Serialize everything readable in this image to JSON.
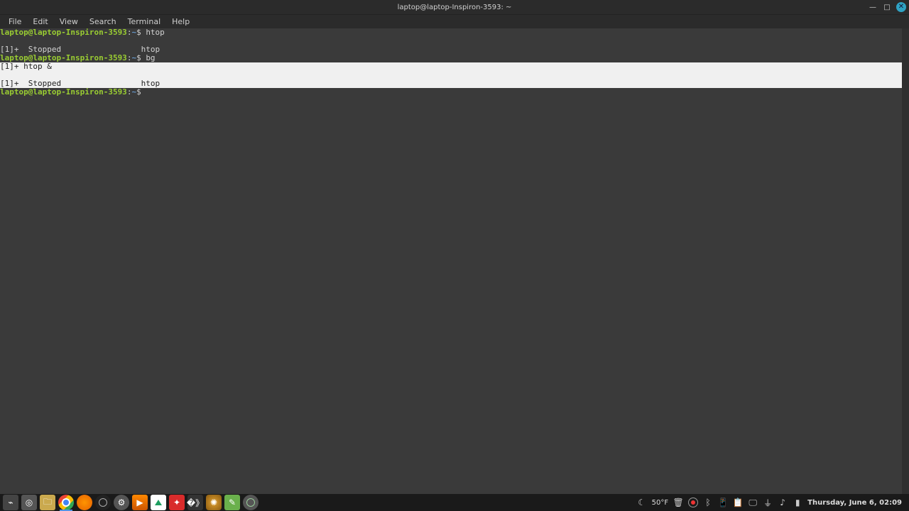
{
  "titlebar": {
    "title": "laptop@laptop-Inspiron-3593: ~"
  },
  "menubar": {
    "items": [
      "File",
      "Edit",
      "View",
      "Search",
      "Terminal",
      "Help"
    ]
  },
  "terminal": {
    "prompt_user": "laptop@laptop-Inspiron-3593",
    "prompt_sep": ":",
    "prompt_path": "~",
    "prompt_sym": "$ ",
    "lines": [
      {
        "type": "prompt",
        "cmd": "htop"
      },
      {
        "type": "blank"
      },
      {
        "type": "job",
        "text": "[1]+  Stopped                 htop"
      },
      {
        "type": "prompt",
        "cmd": "bg"
      },
      {
        "type": "inv",
        "text": "[1]+ htop &"
      },
      {
        "type": "inv",
        "text": " "
      },
      {
        "type": "inv",
        "text": "[1]+  Stopped                 htop"
      },
      {
        "type": "prompt",
        "cmd": ""
      }
    ]
  },
  "taskbar": {
    "apps": [
      {
        "name": "show-desktop",
        "cls": "bg-term",
        "glyph": "⌁",
        "active": false
      },
      {
        "name": "disks",
        "cls": "bg-disk",
        "glyph": "◎",
        "active": false
      },
      {
        "name": "files",
        "cls": "bg-files",
        "glyph": "🗀",
        "active": false
      },
      {
        "name": "chrome",
        "cls": "bg-chrome",
        "glyph": "",
        "active": true
      },
      {
        "name": "firefox",
        "cls": "bg-ff",
        "glyph": "",
        "active": false
      },
      {
        "name": "steam",
        "cls": "bg-steam",
        "glyph": "",
        "active": false
      },
      {
        "name": "settings",
        "cls": "bg-settings",
        "glyph": "⚙",
        "active": false
      },
      {
        "name": "media-player",
        "cls": "bg-play",
        "glyph": "▶",
        "active": false
      },
      {
        "name": "vscode",
        "cls": "bg-vs",
        "glyph": "",
        "active": false
      },
      {
        "name": "app-red",
        "cls": "bg-red",
        "glyph": "✦",
        "active": false
      },
      {
        "name": "app-arrows",
        "cls": "bg-arrow",
        "glyph": "�》",
        "active": false
      },
      {
        "name": "app-octo",
        "cls": "bg-octo",
        "glyph": "✺",
        "active": false
      },
      {
        "name": "app-green",
        "cls": "bg-green",
        "glyph": "✎",
        "active": false
      },
      {
        "name": "mint-menu",
        "cls": "bg-mint",
        "glyph": "",
        "active": false
      }
    ],
    "tray": {
      "weather_glyph": "☾",
      "temp": "50°F",
      "icons": [
        {
          "name": "trash-icon",
          "glyph": "🗑"
        },
        {
          "name": "record-icon",
          "glyph": "rec"
        },
        {
          "name": "bluetooth-icon",
          "glyph": "ᛒ"
        },
        {
          "name": "phone-icon",
          "glyph": "📱"
        },
        {
          "name": "clipboard-icon",
          "glyph": "📋"
        },
        {
          "name": "display-icon",
          "glyph": "🖵"
        },
        {
          "name": "wifi-icon",
          "glyph": "⏚"
        },
        {
          "name": "volume-icon",
          "glyph": "♪"
        },
        {
          "name": "battery-icon",
          "glyph": "▮"
        }
      ],
      "clock": "Thursday, June  6, 02:09"
    }
  }
}
